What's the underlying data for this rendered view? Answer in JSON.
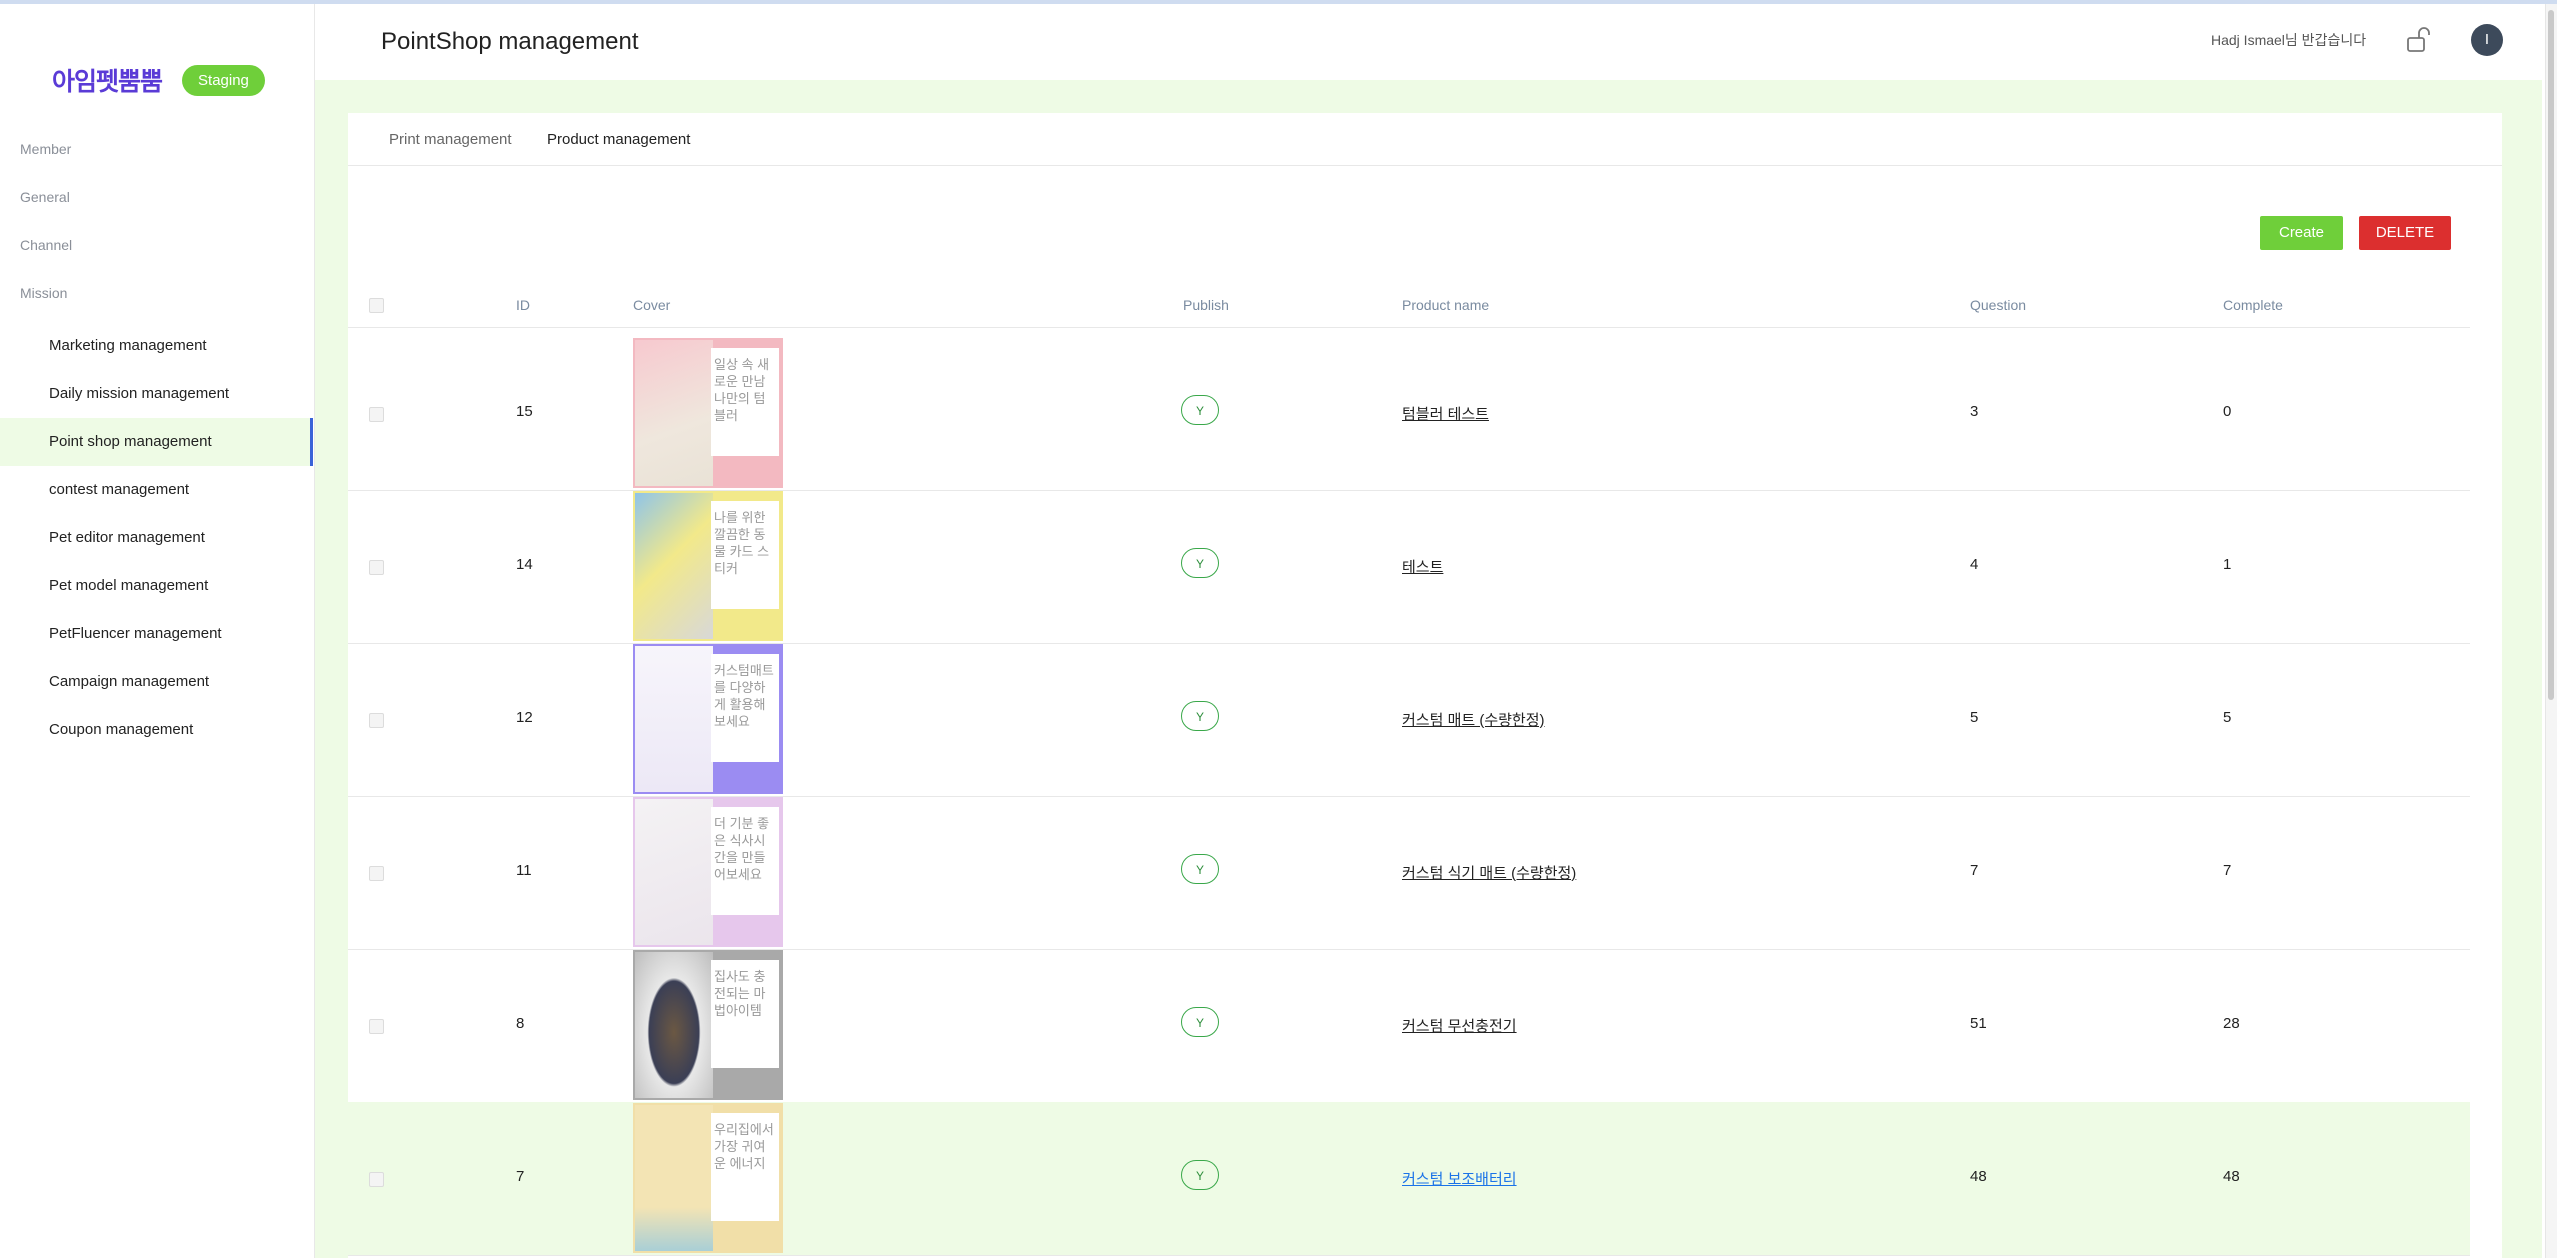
{
  "sidebar": {
    "logo": "아임펫뿜뿜",
    "env_badge": "Staging",
    "groups": [
      "Member",
      "General",
      "Channel",
      "Mission"
    ],
    "items": [
      {
        "label": "Marketing management"
      },
      {
        "label": "Daily mission management"
      },
      {
        "label": "Point shop management"
      },
      {
        "label": "contest management"
      },
      {
        "label": "Pet editor management"
      },
      {
        "label": "Pet model management"
      },
      {
        "label": "PetFluencer management"
      },
      {
        "label": "Campaign management"
      },
      {
        "label": "Coupon management"
      }
    ],
    "active_item": "Point shop management"
  },
  "header": {
    "title": "PointShop management",
    "greeting": "Hadj Ismael님 반갑습니다",
    "lock_icon": "unlock-icon",
    "avatar_initial": "I"
  },
  "tabs": [
    {
      "label": "Print management"
    },
    {
      "label": "Product management"
    }
  ],
  "active_tab": "Product management",
  "actions": {
    "create": "Create",
    "delete": "DELETE"
  },
  "colors": {
    "accent": "#6fcf3a",
    "danger": "#dc2f2f",
    "highlight": "#eefbe5",
    "brand": "#5a3bd6"
  },
  "table": {
    "columns": {
      "id": "ID",
      "cover": "Cover",
      "publish": "Publish",
      "product_name": "Product name",
      "question": "Question",
      "complete": "Complete"
    },
    "rows": [
      {
        "id": "15",
        "cover_text": "일상 속 새로운 만남 나만의 텀블러",
        "cover_bg": "#f3b9c1",
        "publish": "Y",
        "product_name": "텀블러 테스트",
        "question": "3",
        "complete": "0"
      },
      {
        "id": "14",
        "cover_text": "나를 위한 깔끔한 동물 카드 스티커",
        "cover_bg": "#8fc4e8",
        "publish": "Y",
        "product_name": "테스트",
        "question": "4",
        "complete": "1"
      },
      {
        "id": "12",
        "cover_text": "커스텀매트를 다양하게 활용해보세요",
        "cover_bg": "#9b8cf2",
        "publish": "Y",
        "product_name": "커스텀 매트 (수량한정)",
        "question": "5",
        "complete": "5"
      },
      {
        "id": "11",
        "cover_text": "더 기분 좋은 식사시간을 만들어보세요",
        "cover_bg": "#e6c7ec",
        "publish": "Y",
        "product_name": "커스텀 식기 매트 (수량한정)",
        "question": "7",
        "complete": "7"
      },
      {
        "id": "8",
        "cover_text": "집사도 충전되는 마법아이템",
        "cover_bg": "#a9a9a9",
        "publish": "Y",
        "product_name": "커스텀 무선충전기",
        "question": "51",
        "complete": "28"
      },
      {
        "id": "7",
        "cover_text": "우리집에서 가장 귀여운 에너지",
        "cover_bg": "#f1dfa8",
        "publish": "Y",
        "product_name": "커스텀 보조배터리",
        "question": "48",
        "complete": "48"
      }
    ]
  }
}
